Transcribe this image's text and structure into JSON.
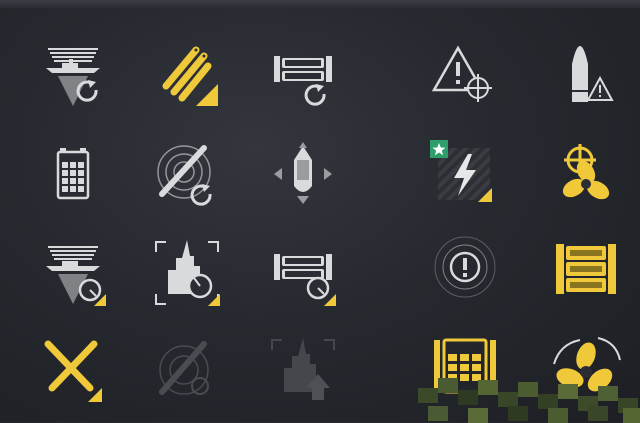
{
  "colors": {
    "background": "#2a2d33",
    "icon_white": "#d9dadc",
    "icon_gold": "#f0c93a",
    "icon_dim": "#4a4c52",
    "badge_green": "#2e9e6b"
  },
  "icons": [
    {
      "name": "hydroacoustic-search-reload-icon",
      "color": "white",
      "badge": "reload"
    },
    {
      "name": "torpedo-reload-gold-icon",
      "color": "gold",
      "badge": "corner-triangle"
    },
    {
      "name": "battery-torpedo-reload-icon",
      "color": "white",
      "badge": "reload"
    },
    {
      "name": "warning-target-icon",
      "color": "white",
      "badge": "none"
    },
    {
      "name": "shell-warning-icon",
      "color": "white",
      "badge": "warning"
    },
    {
      "name": "battery-icon",
      "color": "white",
      "badge": "none"
    },
    {
      "name": "radar-torpedo-reload-icon",
      "color": "white",
      "badge": "reload"
    },
    {
      "name": "ship-maneuver-icon",
      "color": "white",
      "badge": "none"
    },
    {
      "name": "lightning-star-icon",
      "color": "white",
      "badge": "star"
    },
    {
      "name": "engine-propeller-gold-icon",
      "color": "gold",
      "badge": "none"
    },
    {
      "name": "hydroacoustic-timer-icon",
      "color": "white",
      "badge": "timer"
    },
    {
      "name": "castle-focus-timer-icon",
      "color": "white",
      "badge": "timer"
    },
    {
      "name": "battery-timer-icon",
      "color": "white",
      "badge": "timer"
    },
    {
      "name": "alert-radar-icon",
      "color": "white",
      "badge": "none"
    },
    {
      "name": "tank-gold-icon",
      "color": "gold",
      "badge": "none"
    },
    {
      "name": "crossed-torpedoes-gold-icon",
      "color": "gold",
      "badge": "corner-triangle"
    },
    {
      "name": "radar-torpedo-dim-icon",
      "color": "dim",
      "badge": "none"
    },
    {
      "name": "castle-upgrade-dim-icon",
      "color": "dim",
      "badge": "none"
    },
    {
      "name": "battery-gold-icon",
      "color": "gold",
      "badge": "none"
    },
    {
      "name": "propeller-gold-icon",
      "color": "gold",
      "badge": "none"
    }
  ]
}
